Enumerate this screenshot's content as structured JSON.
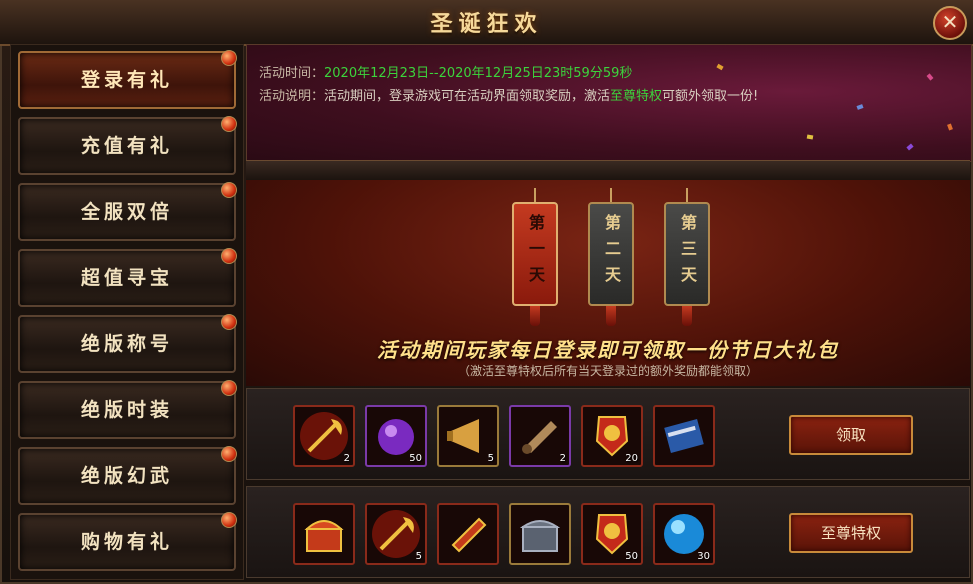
{
  "window": {
    "title": "圣诞狂欢",
    "close_icon": "close-icon"
  },
  "sidebar": {
    "items": [
      {
        "label": "登录有礼",
        "active": true
      },
      {
        "label": "充值有礼",
        "active": false
      },
      {
        "label": "全服双倍",
        "active": false
      },
      {
        "label": "超值寻宝",
        "active": false
      },
      {
        "label": "绝版称号",
        "active": false
      },
      {
        "label": "绝版时装",
        "active": false
      },
      {
        "label": "绝版幻武",
        "active": false
      },
      {
        "label": "购物有礼",
        "active": false
      }
    ]
  },
  "info": {
    "time_label": "活动时间：",
    "time_value": "2020年12月23日--2020年12月25日23时59分59秒",
    "desc_label": "活动说明：",
    "desc_text_1": "活动期间，登录游戏可在活动界面领取奖励，激活",
    "desc_highlight": "至尊特权",
    "desc_text_2": "可额外领取一份!"
  },
  "days": [
    {
      "label": "第一天",
      "active": true
    },
    {
      "label": "第二天",
      "active": false
    },
    {
      "label": "第三天",
      "active": false
    }
  ],
  "headline": "活动期间玩家每日登录即可领取一份节日大礼包",
  "subline": "（激活至尊特权后所有当天登录过的额外奖励都能领取）",
  "rewards": {
    "normal": {
      "button_label": "领取",
      "items": [
        {
          "icon": "golden-axe-icon",
          "qty": "2"
        },
        {
          "icon": "purple-orb-icon",
          "qty": "50"
        },
        {
          "icon": "horn-icon",
          "qty": "5"
        },
        {
          "icon": "scroll-icon",
          "qty": "2"
        },
        {
          "icon": "medal-icon",
          "qty": "20"
        },
        {
          "icon": "blue-scroll-icon",
          "qty": ""
        }
      ]
    },
    "premium": {
      "button_label": "至尊特权",
      "items": [
        {
          "icon": "treasure-chest-icon",
          "qty": ""
        },
        {
          "icon": "golden-axe-icon",
          "qty": "5"
        },
        {
          "icon": "red-scroll-icon",
          "qty": ""
        },
        {
          "icon": "iron-chest-icon",
          "qty": ""
        },
        {
          "icon": "medal-icon",
          "qty": "50"
        },
        {
          "icon": "blue-orb-icon",
          "qty": "30"
        }
      ]
    }
  },
  "colors": {
    "accent_green": "#3cd43c",
    "title_gold": "#f6d99a",
    "button_red": "#8a2210"
  }
}
